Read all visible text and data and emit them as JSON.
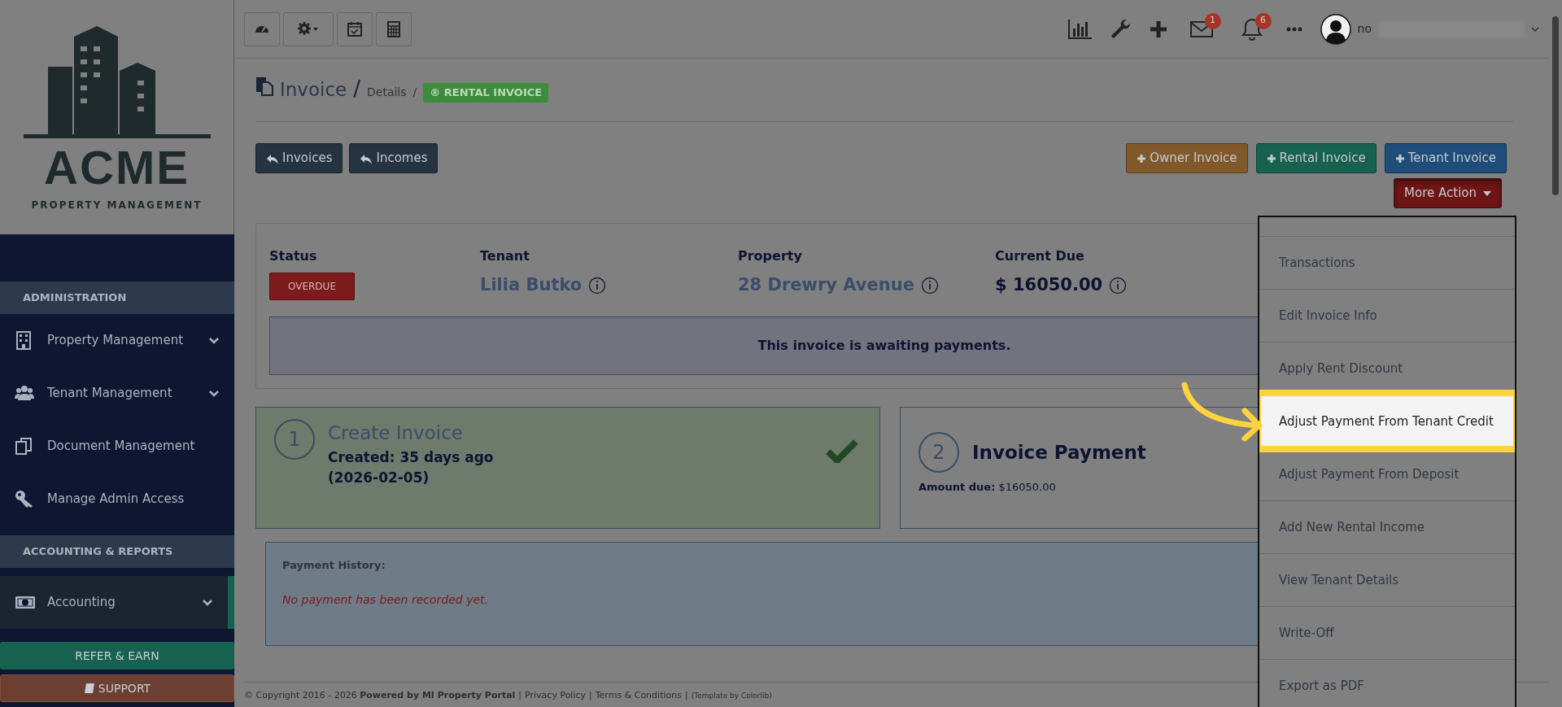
{
  "sidebar": {
    "logo": {
      "name": "ACME",
      "subtitle": "PROPERTY MANAGEMENT"
    },
    "sections": [
      {
        "title": "ADMINISTRATION",
        "items": [
          {
            "label": "Property Management",
            "expandable": true,
            "selected": false
          },
          {
            "label": "Tenant Management",
            "expandable": true,
            "selected": false
          },
          {
            "label": "Document Management",
            "expandable": false,
            "selected": false
          },
          {
            "label": "Manage Admin Access",
            "expandable": false,
            "selected": false
          }
        ]
      },
      {
        "title": "ACCOUNTING & REPORTS",
        "items": [
          {
            "label": "Accounting",
            "expandable": true,
            "selected": true
          }
        ]
      }
    ],
    "buttons": [
      {
        "label": "REFER & EARN",
        "kind": "refer"
      },
      {
        "label": "SUPPORT",
        "kind": "support"
      }
    ]
  },
  "topbar": {
    "badges": [
      {
        "kind": "mail",
        "count": "1"
      },
      {
        "kind": "bell",
        "count": "6"
      }
    ],
    "user": "no"
  },
  "breadcrumb": {
    "title": "Invoice",
    "separator": "/",
    "crumb": "Details",
    "crumb_separator": "/",
    "badge": "® RENTAL INVOICE"
  },
  "nav_buttons": [
    {
      "label": "Invoices"
    },
    {
      "label": "Incomes"
    }
  ],
  "action_buttons": [
    {
      "label": "Owner Invoice",
      "kind": "owner"
    },
    {
      "label": "Rental Invoice",
      "kind": "rental"
    },
    {
      "label": "Tenant Invoice",
      "kind": "tenant"
    }
  ],
  "more_action": {
    "label": "More Action",
    "expanded": true
  },
  "dropdown": [
    {
      "label": "Transactions",
      "selected": false
    },
    {
      "label": "Edit Invoice Info",
      "selected": false
    },
    {
      "label": "Apply Rent Discount",
      "selected": false
    },
    {
      "label": "Adjust Payment From Tenant Credit",
      "selected": true
    },
    {
      "label": "Adjust Payment From Deposit",
      "selected": false
    },
    {
      "label": "Add New Rental Income",
      "selected": false
    },
    {
      "label": "View Tenant Details",
      "selected": false
    },
    {
      "label": "Write-Off",
      "selected": false
    },
    {
      "label": "Export as PDF",
      "selected": false
    }
  ],
  "summary": {
    "columns": [
      {
        "heading": "Status",
        "value": "OVERDUE",
        "kind": "badge"
      },
      {
        "heading": "Tenant",
        "value": "Lilia Butko",
        "kind": "link"
      },
      {
        "heading": "Property",
        "value": "28 Drewry Avenue",
        "kind": "link"
      },
      {
        "heading": "Current Due",
        "value": "$ 16050.00",
        "kind": "amount"
      }
    ],
    "notice": "This invoice is awaiting payments."
  },
  "steps": [
    {
      "number": "1",
      "title": "Create Invoice",
      "detail": "Created: 35 days ago (2026-02-05)",
      "completed": true
    },
    {
      "number": "2",
      "title": "Invoice Payment",
      "detail": "**Amount due:** $16050.00",
      "completed": false
    }
  ],
  "payment_history": {
    "title": "Payment History:",
    "empty": "No payment has been recorded yet."
  },
  "footer": [
    {
      "text": "© Copyright 2016 - 2026 **Powered by MI Property Portal**",
      "kind": "text"
    },
    {
      "text": "|",
      "kind": "sep"
    },
    {
      "text": "Privacy Policy",
      "kind": "link"
    },
    {
      "text": "|",
      "kind": "sep"
    },
    {
      "text": "Terms & Conditions",
      "kind": "link"
    },
    {
      "text": "|",
      "kind": "sep"
    },
    {
      "text": "(Template by Colorlib)",
      "kind": "small"
    }
  ]
}
